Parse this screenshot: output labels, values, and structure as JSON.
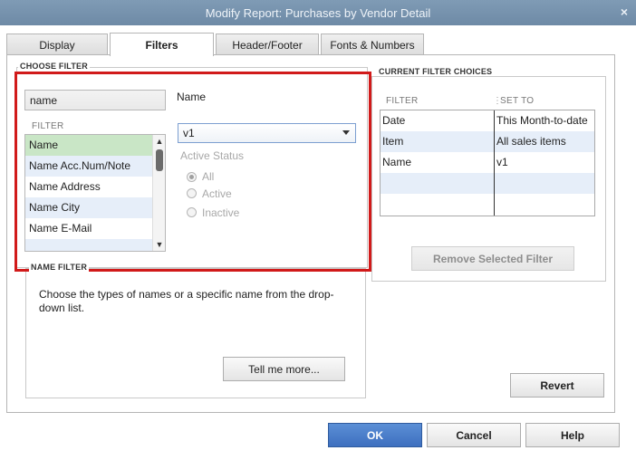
{
  "window": {
    "title": "Modify Report: Purchases by Vendor Detail",
    "close": "×"
  },
  "tabs": [
    {
      "label": "Display"
    },
    {
      "label": "Filters"
    },
    {
      "label": "Header/Footer"
    },
    {
      "label": "Fonts & Numbers"
    }
  ],
  "choose_filter": {
    "caption": "CHOOSE FILTER",
    "search_value": "name",
    "list_header": "FILTER",
    "items": [
      "Name",
      "Name Acc.Num/Note",
      "Name Address",
      "Name City",
      "Name E-Mail"
    ],
    "selected_index": 0,
    "scroll_up": "▲",
    "scroll_down": "▼"
  },
  "name_filter_controls": {
    "heading": "Name",
    "select_value": "v1",
    "active_status_label": "Active Status",
    "radios": [
      "All",
      "Active",
      "Inactive"
    ],
    "checked_radio": "All"
  },
  "name_filter_box": {
    "caption": "NAME FILTER",
    "description": "Choose the types of names or a specific name from the drop-down list.",
    "tell_more": "Tell me more..."
  },
  "current_filters": {
    "caption": "CURRENT FILTER CHOICES",
    "col_filter": "FILTER",
    "col_set_to": "SET TO",
    "rows": [
      {
        "filter": "Date",
        "set_to": "This Month-to-date"
      },
      {
        "filter": "Item",
        "set_to": "All sales items"
      },
      {
        "filter": "Name",
        "set_to": "v1"
      },
      {
        "filter": "",
        "set_to": ""
      },
      {
        "filter": "",
        "set_to": ""
      }
    ],
    "remove_button": "Remove Selected Filter"
  },
  "buttons": {
    "revert": "Revert",
    "ok": "OK",
    "cancel": "Cancel",
    "help": "Help"
  }
}
